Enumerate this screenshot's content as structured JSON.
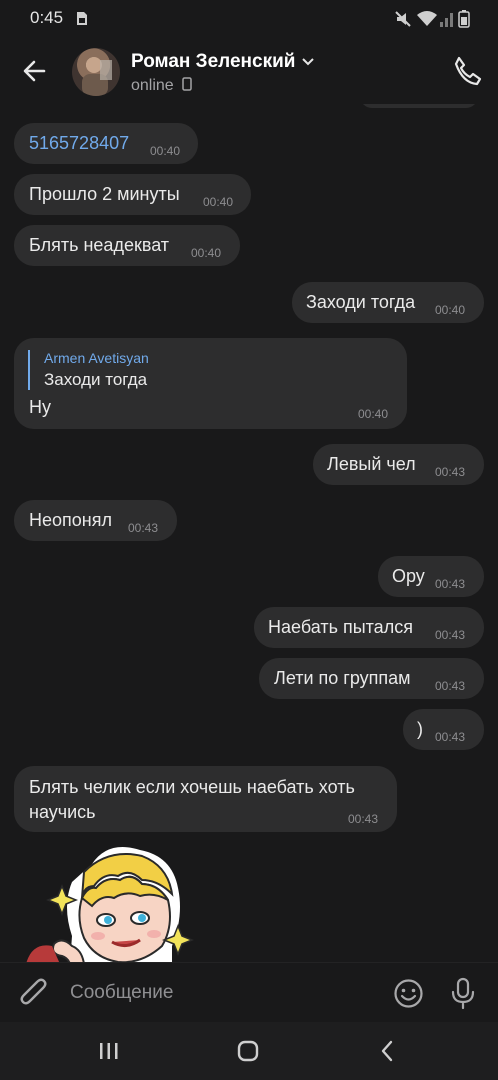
{
  "status_bar": {
    "time": "0:45"
  },
  "header": {
    "name": "Роман Зеленский",
    "status": "online"
  },
  "messages": [
    {
      "text": "5165728407",
      "time": "00:40",
      "side": "in"
    },
    {
      "text": "Прошло 2 минуты",
      "time": "00:40",
      "side": "in"
    },
    {
      "text": "Блять неадекват",
      "time": "00:40",
      "side": "in"
    },
    {
      "text": "Заходи тогда",
      "time": "00:40",
      "side": "out"
    },
    {
      "reply_author": "Armen Avetisyan",
      "reply_text": "Заходи тогда",
      "text": "Ну",
      "time": "00:40",
      "side": "in"
    },
    {
      "text": "Левый чел",
      "time": "00:43",
      "side": "out"
    },
    {
      "text": "Неопонял",
      "time": "00:43",
      "side": "in"
    },
    {
      "text": "Ору",
      "time": "00:43",
      "side": "out"
    },
    {
      "text": "Наебать пытался",
      "time": "00:43",
      "side": "out"
    },
    {
      "text": "Лети по группам",
      "time": "00:43",
      "side": "out"
    },
    {
      "text": ")",
      "time": "00:43",
      "side": "out"
    },
    {
      "text_line1": "Блять челик если хочешь наебать хоть",
      "text_line2": "научись",
      "time": "00:43",
      "side": "in"
    }
  ],
  "composer": {
    "placeholder": "Сообщение"
  },
  "icons": {
    "back": "arrow-left-icon",
    "call": "phone-icon",
    "attach": "paperclip-icon",
    "emoji": "smile-icon",
    "mic": "microphone-icon",
    "nav_recent": "recent-apps-icon",
    "nav_home": "home-icon",
    "nav_back": "nav-back-icon"
  },
  "colors": {
    "background": "#19191a",
    "bubble": "#2d2d2e",
    "link": "#71aaeb",
    "meta": "#8d8d90"
  }
}
